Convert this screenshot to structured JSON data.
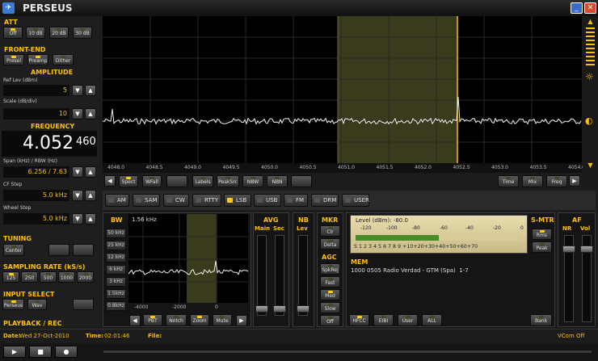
{
  "app": {
    "title": "PERSEUS"
  },
  "att": {
    "label": "ATT",
    "buttons": [
      "Off",
      "10 dB",
      "20 dB",
      "30 dB"
    ],
    "active": 0
  },
  "frontend": {
    "label": "FRONT-END",
    "buttons": [
      "Presel",
      "Preamp",
      "Dither"
    ],
    "active": [
      0,
      1
    ]
  },
  "amplitude": {
    "label": "AMPLITUDE",
    "ref_label": "Ref Lev (dBm)",
    "ref_value": "5",
    "scale_label": "Scale (dB/div)",
    "scale_value": "10"
  },
  "frequency": {
    "label": "FREQUENCY",
    "main": "4.052",
    "fine": "460",
    "span_label": "Span (kHz) / RBW (Hz)",
    "span_value": "6.256 / 7.63",
    "cf_label": "CF Step",
    "cf_value": "5.0 kHz",
    "wheel_label": "Wheel Step",
    "wheel_value": "5.0 kHz"
  },
  "tuning": {
    "label": "TUNING",
    "center": "Center"
  },
  "sampling": {
    "label": "SAMPLING RATE (kS/s)",
    "buttons": [
      "125",
      "250",
      "500",
      "1000",
      "2000"
    ],
    "active": 0
  },
  "input": {
    "label": "INPUT SELECT",
    "buttons": [
      "Perseus",
      "Wav"
    ],
    "active": 0
  },
  "playback": {
    "label": "PLAYBACK / REC"
  },
  "status": {
    "date_label": "Date:",
    "date": "Wed 27-Oct-2010",
    "time_label": "Time:",
    "time": "02:01:46",
    "file_label": "File:",
    "vcom": "VCom Off"
  },
  "spectrum": {
    "freq_ticks": [
      "4048.0",
      "4048.5",
      "4049.0",
      "4049.5",
      "4050.0",
      "4050.5",
      "4051.0",
      "4051.5",
      "4052.0",
      "4052.5",
      "4053.0",
      "4053.5",
      "4054.0"
    ]
  },
  "spectrum_buttons": [
    "Spect",
    "WFall",
    "",
    "Labels",
    "PeakSrc",
    "NBW",
    "NBN",
    ""
  ],
  "right_buttons": [
    "Time",
    "Mix",
    "Freq"
  ],
  "modes": {
    "items": [
      "AM",
      "SAM",
      "CW",
      "RTTY",
      "LSB",
      "USB",
      "FM",
      "DRM",
      "USER"
    ],
    "active": 4
  },
  "bw": {
    "label": "BW",
    "items": [
      "50 kHz",
      "25 kHz",
      "12 kHz",
      "6 kHz",
      "3 kHz",
      "1.5kHz",
      "0.8kHz"
    ],
    "readout": "1.56 kHz",
    "ticks": [
      "-4000",
      "-2000",
      "0"
    ],
    "bottom_buttons": [
      "PBT",
      "Notch",
      "Zoom",
      "Mute"
    ]
  },
  "avg": {
    "label": "AVG",
    "main": "Main",
    "sec": "Sec"
  },
  "nb": {
    "label": "NB",
    "lev": "Lev"
  },
  "mkr": {
    "label": "MKR",
    "buttons": [
      "Clr",
      "Delta"
    ]
  },
  "agc": {
    "label": "AGC",
    "buttons": [
      "SpkRej",
      "Fast",
      "Med",
      "Slow",
      "Off"
    ],
    "active": [
      2
    ]
  },
  "smeter": {
    "level_label": "Level (dBm): -80.0",
    "dbm_ticks": [
      "-120",
      "-100",
      "-80",
      "-60",
      "-40",
      "-20",
      "0"
    ],
    "s_ticks": "S 1 2 3 4 5 6 7 8 9 +10+20+30+40+50+60+70",
    "level_fraction": 0.5
  },
  "smtr": {
    "label": "S-MTR",
    "buttons": [
      "Rms",
      "Peak"
    ]
  },
  "af": {
    "label": "AF",
    "nr": "NR",
    "vol": "Vol"
  },
  "mem": {
    "label": "MEM",
    "entry": "1000 0505 Radio Verdad - GTM (Spa)  1-7",
    "buttons": [
      "HFCC",
      "EIBI",
      "User",
      "ALL"
    ],
    "bank": "Bank"
  }
}
